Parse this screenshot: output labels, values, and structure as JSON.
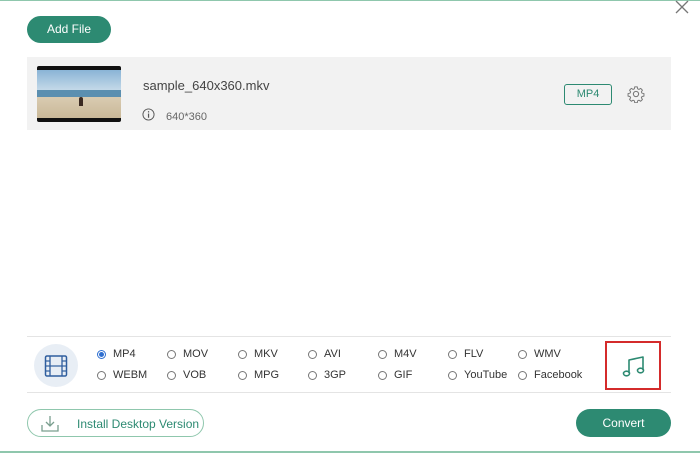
{
  "toolbar": {
    "add_file_label": "Add File"
  },
  "file": {
    "name": "sample_640x360.mkv",
    "resolution": "640*360",
    "output_format": "MP4"
  },
  "format_bar": {
    "selected": "MP4",
    "video_formats": [
      [
        "MP4",
        "MOV",
        "MKV",
        "AVI",
        "M4V",
        "FLV",
        "WMV"
      ],
      [
        "WEBM",
        "VOB",
        "MPG",
        "3GP",
        "GIF",
        "YouTube",
        "Facebook"
      ]
    ]
  },
  "footer": {
    "install_label": "Install Desktop Version",
    "convert_label": "Convert"
  },
  "colors": {
    "accent": "#2d8a72",
    "highlight_border": "#d42b2b",
    "radio_selected": "#2f6fd0"
  },
  "icons": {
    "close": "close-icon",
    "info": "info-icon",
    "settings": "gear-icon",
    "video_tab": "film-icon",
    "audio_tab": "music-note-icon",
    "install": "download-icon"
  }
}
